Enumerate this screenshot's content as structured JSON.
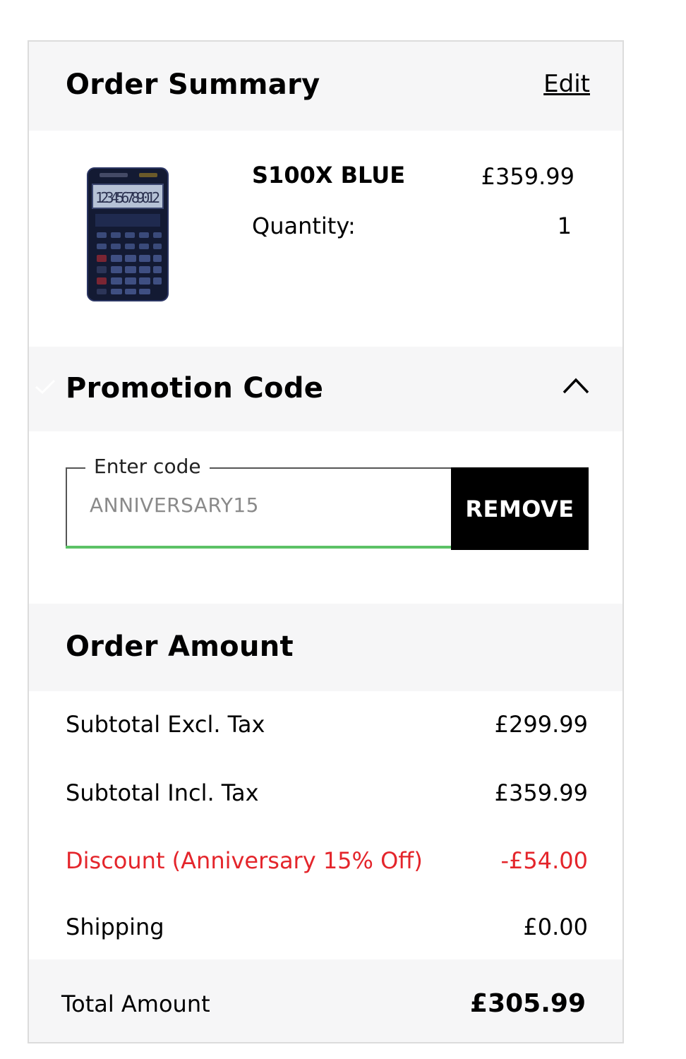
{
  "order_summary": {
    "title": "Order Summary",
    "edit_label": "Edit"
  },
  "product": {
    "image_icon": "calculator-image",
    "name": "S100X BLUE",
    "price": "£359.99",
    "quantity_label": "Quantity:",
    "quantity_value": "1"
  },
  "promotion": {
    "title": "Promotion Code",
    "field_label": "Enter code",
    "code_value": "ANNIVERSARY15",
    "remove_label": "REMOVE",
    "accent_color": "#5cc266"
  },
  "order_amount": {
    "title": "Order Amount",
    "rows": [
      {
        "label": "Subtotal Excl. Tax",
        "value": "£299.99"
      },
      {
        "label": "Subtotal Incl. Tax",
        "value": "£359.99"
      },
      {
        "label": "Discount (Anniversary 15% Off)",
        "value": "-£54.00"
      },
      {
        "label": "Shipping",
        "value": "£0.00"
      }
    ],
    "discount_color": "#e4252b",
    "total_label": "Total Amount",
    "total_value": "£305.99"
  }
}
